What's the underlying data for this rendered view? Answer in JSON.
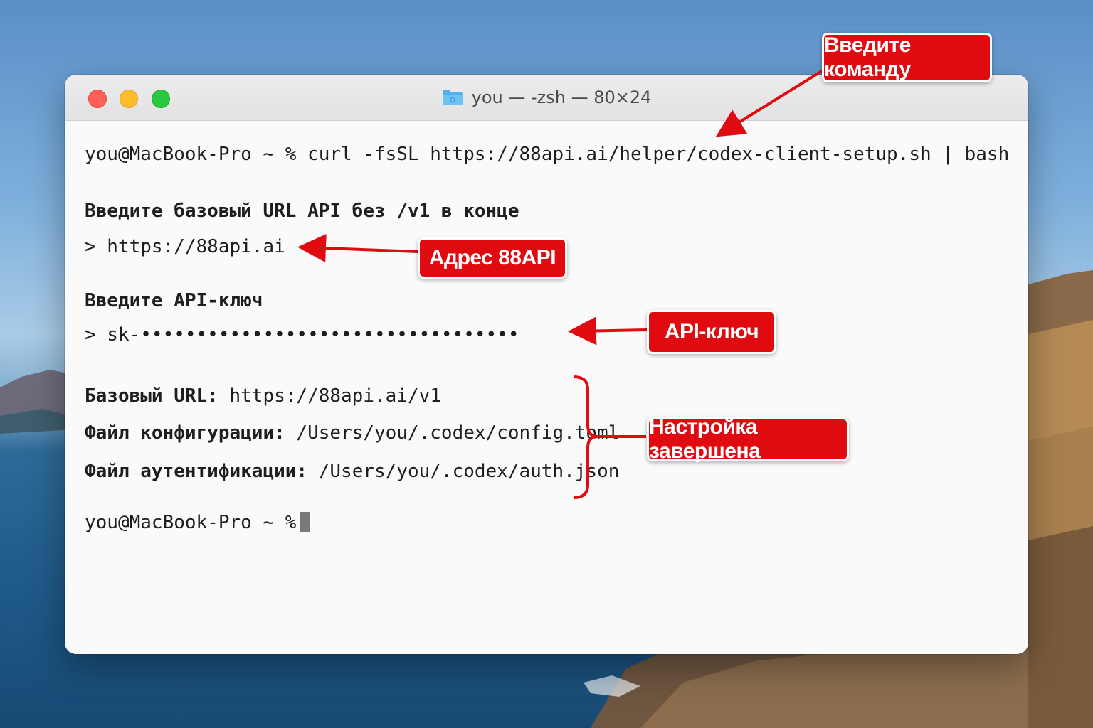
{
  "window": {
    "title": "you — -zsh — 80×24"
  },
  "terminal": {
    "command_line": "you@MacBook-Pro ~ % curl -fsSL https://88api.ai/helper/codex-client-setup.sh | bash",
    "prompt_url_label": "Введите базовый URL API без /v1 в конце",
    "prompt_url_value": "> https://88api.ai",
    "prompt_key_label": "Введите API-ключ",
    "prompt_key_value": "> sk-••••••••••••••••••••••••••••••••••",
    "result_base_url_label": "Базовый URL:",
    "result_base_url_value": " https://88api.ai/v1",
    "result_config_label": "Файл конфигурации:",
    "result_config_value": " /Users/you/.codex/config.toml",
    "result_auth_label": "Файл аутентификации:",
    "result_auth_value": " /Users/you/.codex/auth.json",
    "final_prompt": "you@MacBook-Pro ~ %"
  },
  "callouts": {
    "command": "Введите команду",
    "address": "Адрес 88API",
    "key": "API-ключ",
    "done": "Настройка завершена"
  },
  "colors": {
    "accent": "#e00b10",
    "terminal_bg": "#fafafa",
    "text": "#1e1e1e"
  }
}
